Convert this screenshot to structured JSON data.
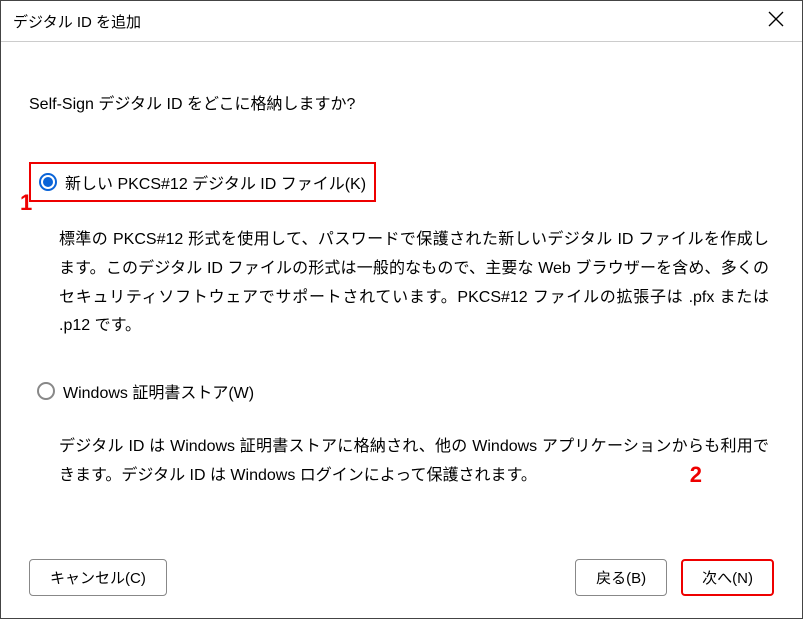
{
  "dialog": {
    "title": "デジタル ID を追加",
    "question": "Self-Sign デジタル ID をどこに格納しますか?",
    "options": [
      {
        "label": "新しい PKCS#12 デジタル ID ファイル(K)",
        "selected": true,
        "description": "標準の PKCS#12 形式を使用して、パスワードで保護された新しいデジタル ID ファイルを作成します。このデジタル ID ファイルの形式は一般的なもので、主要な Web ブラウザーを含め、多くのセキュリティソフトウェアでサポートされています。PKCS#12 ファイルの拡張子は .pfx または .p12 です。"
      },
      {
        "label": "Windows 証明書ストア(W)",
        "selected": false,
        "description": "デジタル ID は Windows 証明書ストアに格納され、他の Windows アプリケーションからも利用できます。デジタル ID は Windows ログインによって保護されます。"
      }
    ],
    "buttons": {
      "cancel": "キャンセル(C)",
      "back": "戻る(B)",
      "next": "次へ(N)"
    }
  },
  "annotations": {
    "a1": "1",
    "a2": "2"
  }
}
